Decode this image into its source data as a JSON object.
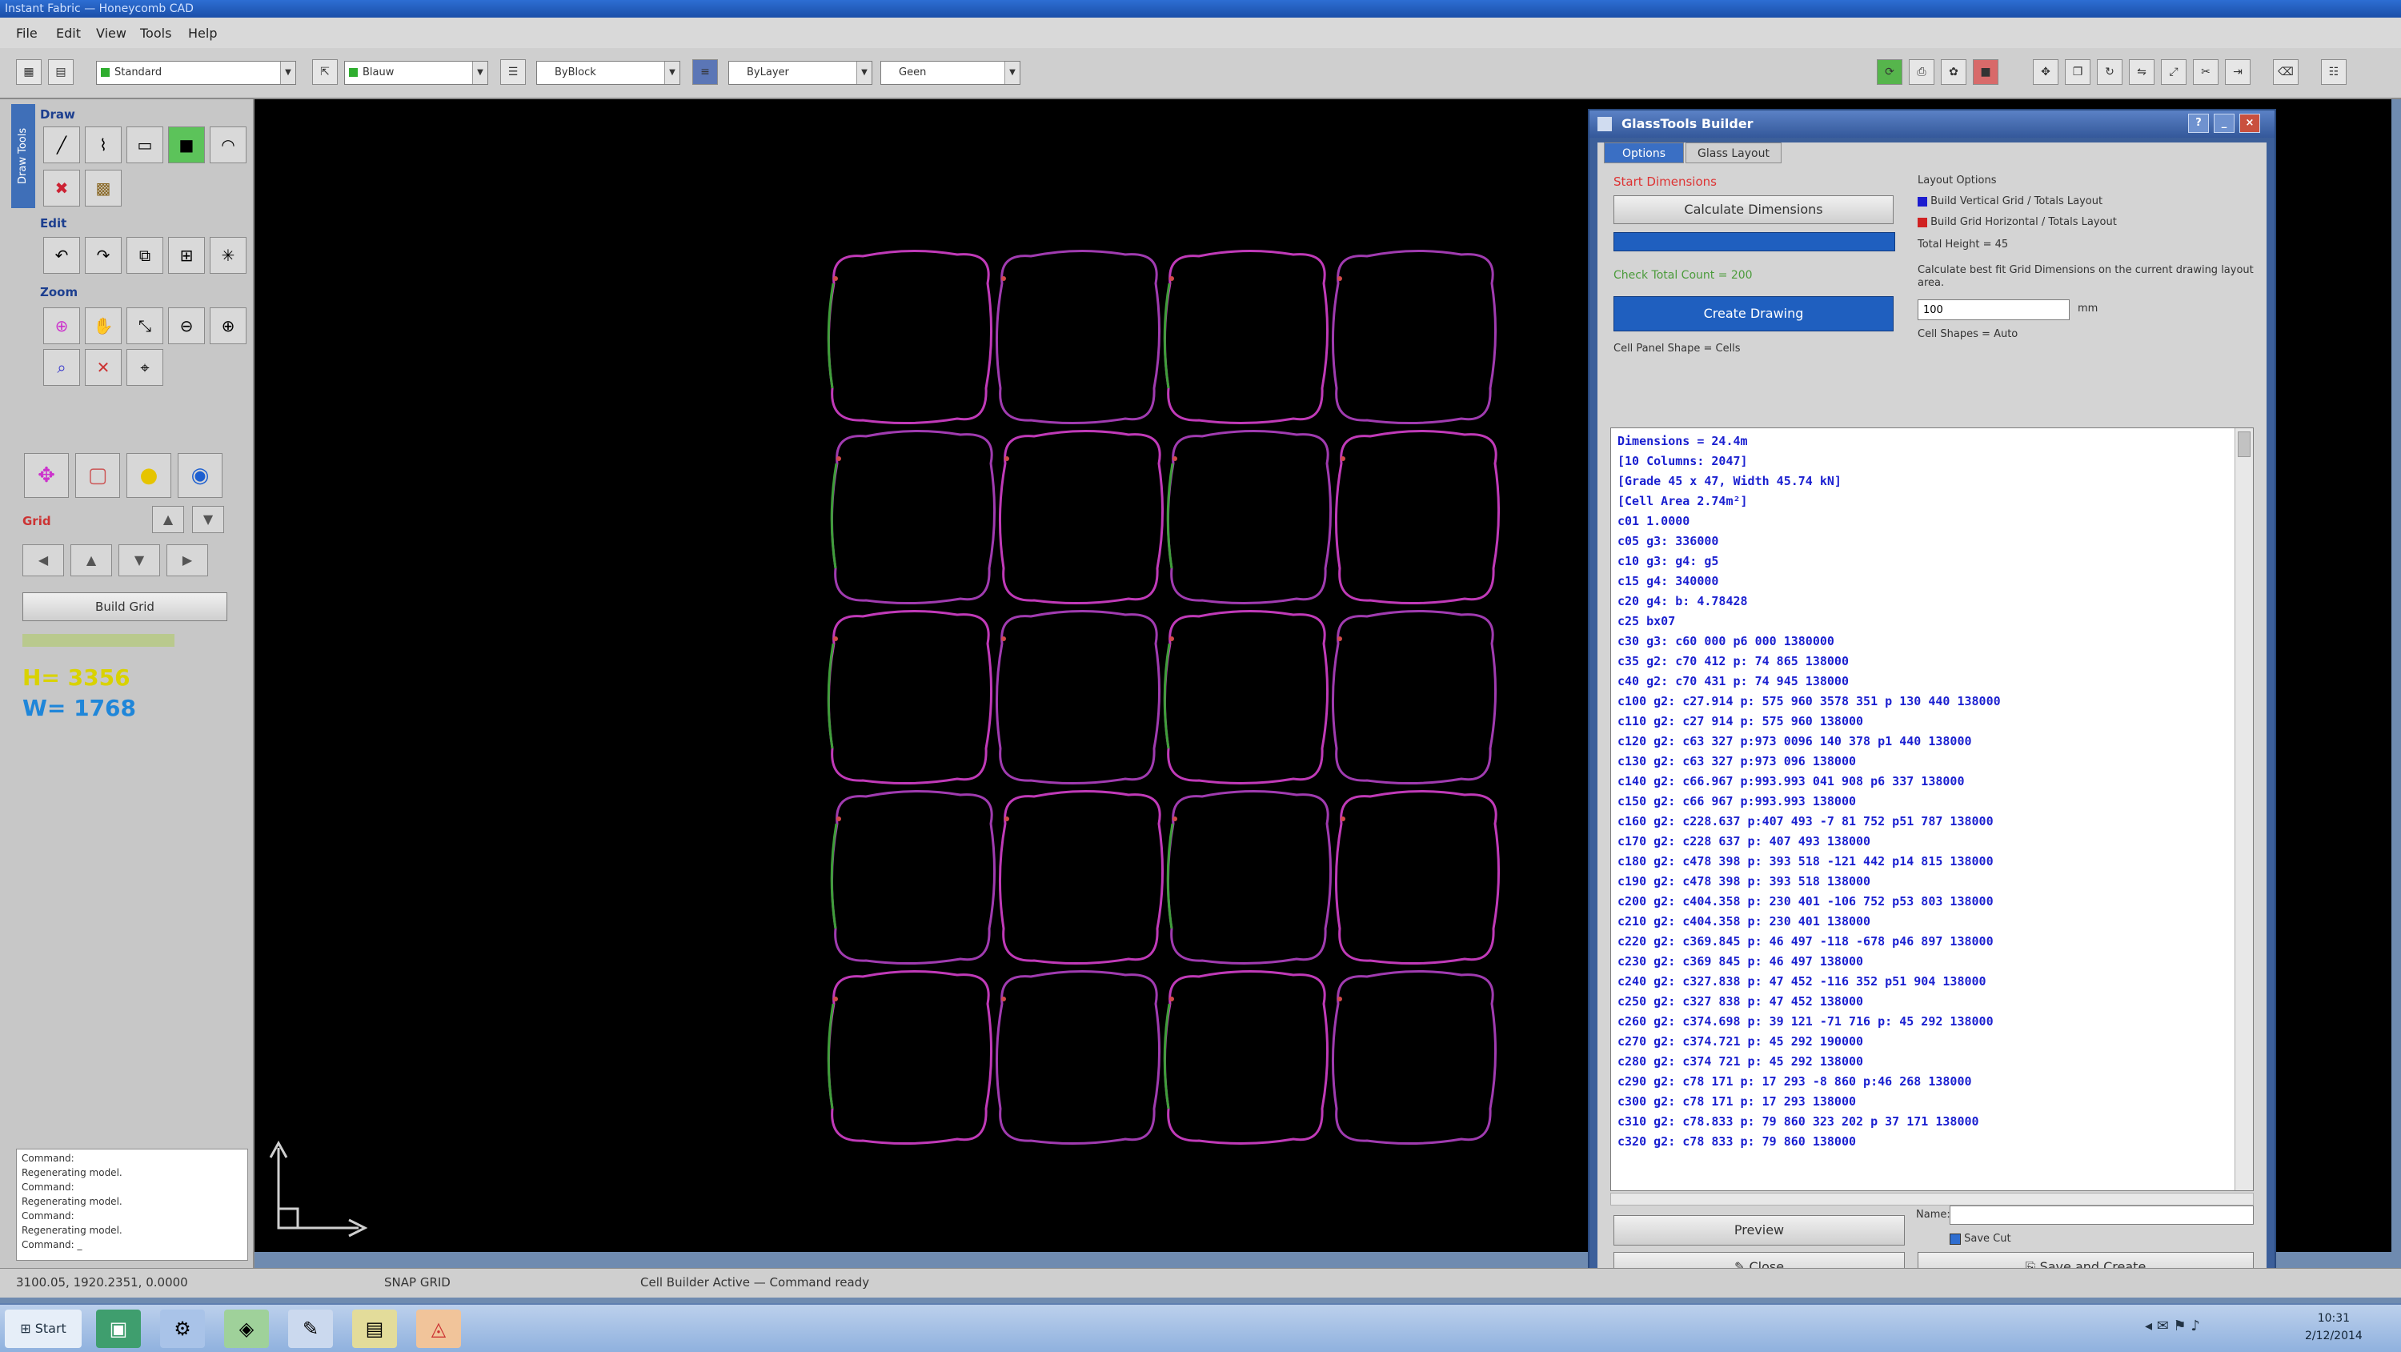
{
  "window": {
    "title": "Instant Fabric — Honeycomb CAD"
  },
  "menu": {
    "items": [
      "File",
      "Edit",
      "View",
      "Tools",
      "Help"
    ]
  },
  "toolbar": {
    "layer_value": "Standard",
    "color_value": "Blauw",
    "linetype_value": "ByBlock",
    "lineweight_value": "ByLayer",
    "plot_value": "Geen",
    "color_swatch": "#2fae2f"
  },
  "left_panel": {
    "tab_label": "Draw Tools",
    "group_draw": "Draw",
    "group_edit": "Edit",
    "group_zoom": "Zoom",
    "group_grid": "Grid",
    "gridbuild_label": "Build Grid",
    "fit_label": "",
    "h_value": "H= 3356",
    "w_value": "W= 1768",
    "log_lines": [
      "Command:",
      "Regenerating model.",
      "Command:",
      "Regenerating model.",
      "Command:",
      "Regenerating model.",
      "Command: _"
    ]
  },
  "dialog": {
    "title": "GlassTools Builder",
    "tabs": [
      "Options",
      "Glass Layout"
    ],
    "red_label": "Start Dimensions",
    "calc_button": "Calculate Dimensions",
    "green_label": "Check Total Count = 200",
    "create_button": "Create Drawing",
    "small_label": "Cell Panel Shape = Cells",
    "info_group_title": "Layout Options",
    "opt1": "Build Vertical Grid / Totals Layout",
    "opt2": "Build Grid Horizontal / Totals Layout",
    "total_height": "Total Height = 45",
    "hint": "Calculate best fit Grid Dimensions on the current drawing layout area.",
    "spacing_value": "100",
    "spacing_unit": "mm",
    "shapes_label": "Cell Shapes = Auto",
    "results": [
      "Dimensions = 24.4m",
      "[10 Columns: 2047]",
      "[Grade 45 x 47, Width 45.74 kN]",
      "[Cell Area 2.74m²]",
      "c01  1.0000",
      "c05  g3: 336000",
      "c10  g3: g4: g5",
      "c15  g4: 340000",
      "c20  g4: b: 4.78428",
      "c25  bx07",
      "c30  g3: c60 000 p6 000 1380000",
      "c35  g2: c70 412 p: 74 865 138000",
      "c40  g2: c70 431 p: 74 945 138000",
      "c100 g2: c27.914 p: 575 960 3578 351 p 130 440 138000",
      "c110 g2: c27 914 p: 575 960 138000",
      "c120 g2: c63 327 p:973 0096 140 378 p1 440 138000",
      "c130 g2: c63 327 p:973 096 138000",
      "c140 g2: c66.967 p:993.993 041 908 p6 337 138000",
      "c150 g2: c66 967 p:993.993 138000",
      "c160 g2: c228.637 p:407 493 -7 81 752 p51 787 138000",
      "c170 g2: c228 637 p: 407 493 138000",
      "c180 g2: c478 398 p: 393 518 -121 442 p14 815 138000",
      "c190 g2: c478 398 p: 393 518 138000",
      "c200 g2: c404.358 p: 230 401 -106 752 p53 803 138000",
      "c210 g2: c404.358 p: 230 401 138000",
      "c220 g2: c369.845 p: 46 497 -118 -678 p46 897 138000",
      "c230 g2: c369 845 p: 46 497 138000",
      "c240 g2: c327.838 p: 47 452 -116 352 p51 904 138000",
      "c250 g2: c327 838 p: 47 452 138000",
      "c260 g2: c374.698 p: 39 121 -71 716 p: 45 292 138000",
      "c270 g2: c374.721 p: 45 292 190000",
      "c280 g2: c374 721 p: 45 292 138000",
      "c290 g2: c78 171 p: 17 293 -8 860 p:46 268 138000",
      "c300 g2: c78 171 p: 17 293 138000",
      "c310 g2: c78.833 p: 79 860 323 202 p 37 171 138000",
      "c320 g2: c78 833 p: 79 860 138000"
    ],
    "name_label": "Name:",
    "name_value": "",
    "preview_button": "Preview",
    "save_checkbox": "Save Cut",
    "close_button": "Close",
    "savecreate_button": "Save and Create"
  },
  "status": {
    "coords": "3100.05, 1920.2351, 0.0000",
    "snap": "SNAP GRID",
    "model": "Cell Builder Active — Command ready"
  },
  "taskbar": {
    "start_label": "Start",
    "clock_time": "10:31",
    "clock_date": "2/12/2014"
  },
  "drawing": {
    "rows": 5,
    "cols": 4,
    "colors": [
      "#c03ab8",
      "#3f9e3a",
      "#d24a4a",
      "#a03bb0"
    ]
  }
}
